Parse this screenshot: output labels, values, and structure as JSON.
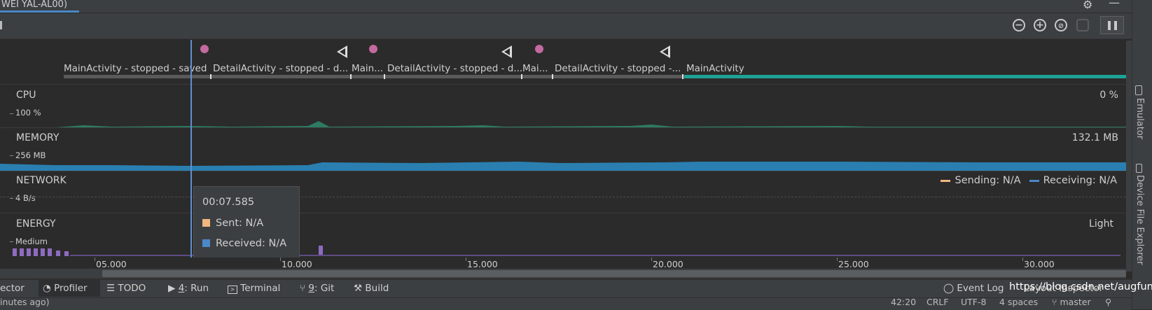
{
  "device_tab": "WEI YAL-AL00)",
  "toolbar": {
    "zoom_out_icon": "zoom-out-icon",
    "zoom_in_icon": "zoom-in-icon",
    "reset_zoom_icon": "reset-zoom-icon",
    "jump_live_icon": "jump-to-live-icon",
    "pause_icon": "pause-icon"
  },
  "activities": [
    "MainActivity - stopped - saved",
    "DetailActivity - stopped - d...",
    "Main...",
    "DetailActivity - stopped - d...",
    "Mai...",
    "DetailActivity - stopped -...",
    "MainActivity"
  ],
  "monitors": {
    "cpu": {
      "title": "CPU",
      "scale": "100 %",
      "value": "0 %"
    },
    "memory": {
      "title": "MEMORY",
      "scale": "256 MB",
      "value": "132.1 MB"
    },
    "network": {
      "title": "NETWORK",
      "scale": "4 B/s",
      "sending": "Sending: N/A",
      "receiving": "Receiving: N/A"
    },
    "energy": {
      "title": "ENERGY",
      "scale": "Medium",
      "value": "Light"
    }
  },
  "tooltip": {
    "time": "00:07.585",
    "sent": "Sent: N/A",
    "received": "Received: N/A"
  },
  "colors": {
    "sending": "#f2b77e",
    "receiving": "#4a88c7",
    "memory": "#2a7fb0",
    "cpu": "#2e7a63",
    "energy": "#8e6bc2",
    "cursor": "#5f8fd0",
    "live_bar": "#1fa296"
  },
  "time_axis": [
    "05.000",
    "10.000",
    "15.000",
    "20.000",
    "25.000",
    "30.000"
  ],
  "right_tools": [
    "Emulator",
    "Device File Explorer"
  ],
  "bottom_tools": {
    "inspector": "ector",
    "profiler": "Profiler",
    "todo": "TODO",
    "run_num": "4",
    "run": ": Run",
    "terminal": "Terminal",
    "git_num": "9",
    "git": ": Git",
    "build": "Build",
    "event_log": "Event Log",
    "layout_inspector": "Layout Inspector"
  },
  "status_bar": {
    "left": "inutes ago)",
    "position": "42:20",
    "line_sep": "CRLF",
    "encoding": "UTF-8",
    "indent": "4 spaces",
    "branch": "master"
  },
  "watermark": "https://blog.csdn.net/augfun"
}
